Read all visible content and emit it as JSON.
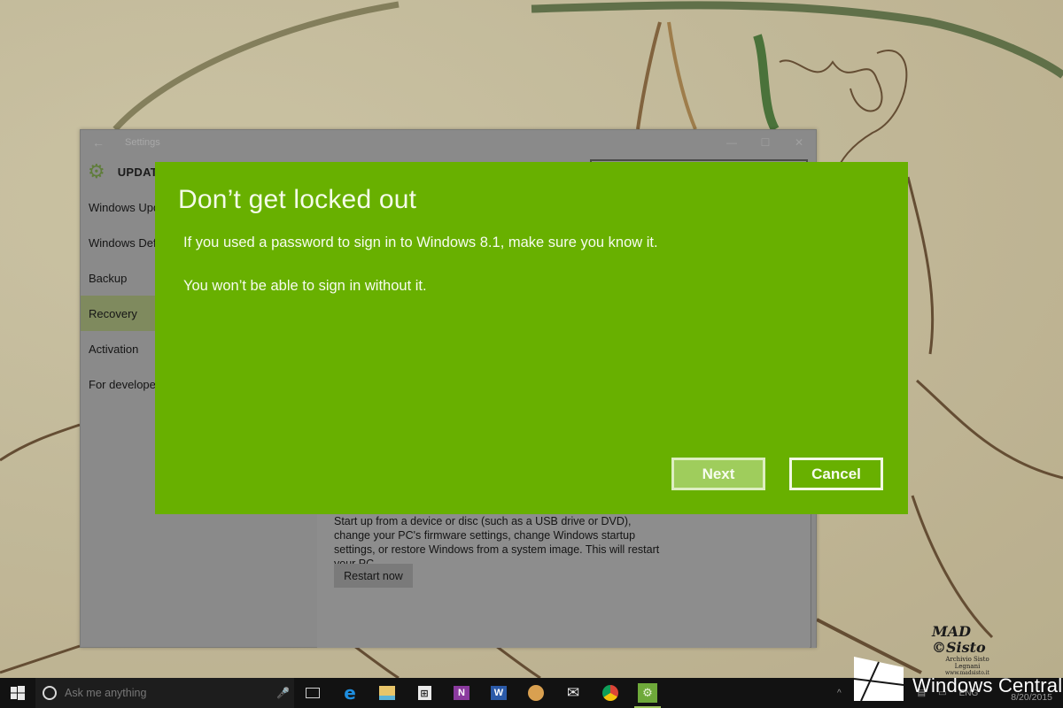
{
  "settings_window": {
    "title": "Settings",
    "section_title": "UPDATE & SECURITY",
    "controls": {
      "minimize": "—",
      "maximize": "☐",
      "close": "✕"
    },
    "back_icon": "←",
    "nav_items": [
      {
        "label": "Windows Update",
        "active": false
      },
      {
        "label": "Windows Defender",
        "active": false
      },
      {
        "label": "Backup",
        "active": false
      },
      {
        "label": "Recovery",
        "active": true
      },
      {
        "label": "Activation",
        "active": false
      },
      {
        "label": "For developers",
        "active": false
      }
    ],
    "advanced_startup": {
      "description": "Start up from a device or disc (such as a USB drive or DVD), change your PC's firmware settings, change Windows startup settings, or restore Windows from a system image. This will restart your PC.",
      "button_label": "Restart now"
    }
  },
  "dialog": {
    "title": "Don’t get locked out",
    "line1": "If you used a password to sign in to Windows 8.1, make sure you know it.",
    "line2": "You won’t be able to sign in without it.",
    "next_label": "Next",
    "cancel_label": "Cancel",
    "accent_color": "#68b000"
  },
  "taskbar": {
    "search_placeholder": "Ask me anything",
    "pinned_apps": [
      {
        "name": "task-view",
        "glyph": "▭"
      },
      {
        "name": "edge",
        "glyph": "e"
      },
      {
        "name": "file-explorer",
        "glyph": "▬"
      },
      {
        "name": "store",
        "glyph": "▣"
      },
      {
        "name": "onenote",
        "glyph": "N"
      },
      {
        "name": "word",
        "glyph": "W"
      },
      {
        "name": "paint",
        "glyph": "●"
      },
      {
        "name": "mail",
        "glyph": "✉"
      },
      {
        "name": "chrome",
        "glyph": "◉"
      },
      {
        "name": "settings",
        "glyph": "⚙"
      }
    ],
    "tray": {
      "chevron": "^",
      "volume": "🔈",
      "notifications": "▤",
      "keyboard": "▭",
      "language": "ENG",
      "date": "8/20/2015"
    }
  },
  "watermark": {
    "signature": "MAD ©Sisto",
    "archive": "Archivio Sisto Legnani",
    "url": "www.madsisto.it",
    "brand": "Windows Central"
  }
}
